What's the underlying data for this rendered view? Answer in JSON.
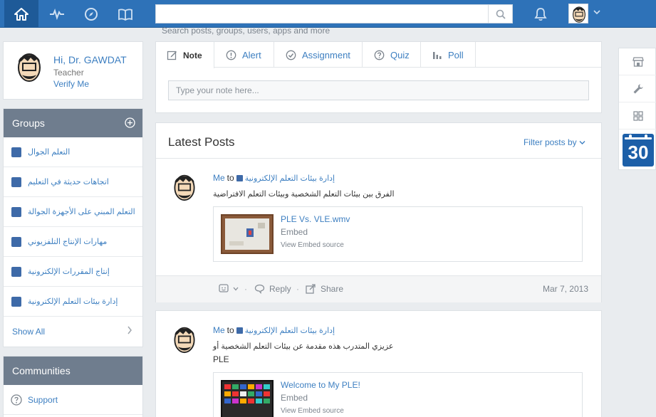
{
  "topbar": {
    "search_placeholder": "",
    "search_hint": "Search posts, groups, users, apps and more"
  },
  "profile": {
    "greeting": "Hi, Dr. GAWDAT",
    "role": "Teacher",
    "verify": "Verify Me"
  },
  "groups": {
    "title": "Groups",
    "items": [
      {
        "label": "التعلم الجوال"
      },
      {
        "label": "اتجاهات حديثة في التعليم"
      },
      {
        "label": "التعلم المبني على الأجهزة الجوالة"
      },
      {
        "label": "مهارات الإنتاج التلفزيوني"
      },
      {
        "label": "إنتاج المقررات الإلكترونية"
      },
      {
        "label": "إدارة بيئات التعلم الإلكترونية"
      }
    ],
    "show_all": "Show All"
  },
  "communities": {
    "title": "Communities",
    "items": [
      {
        "label": "Support"
      }
    ]
  },
  "composer": {
    "tabs": [
      {
        "label": "Note",
        "active": true
      },
      {
        "label": "Alert"
      },
      {
        "label": "Assignment"
      },
      {
        "label": "Quiz"
      },
      {
        "label": "Poll"
      }
    ],
    "placeholder": "Type your note here..."
  },
  "feed": {
    "title": "Latest Posts",
    "filter": "Filter posts by",
    "posts": [
      {
        "author": "Me",
        "to": "to",
        "group": "إدارة بيئات التعلم الإلكترونية",
        "text": "الفرق بين بيئات التعلم الشخصية وبيئات التعلم الافتراضية",
        "embed_title": "PLE Vs. VLE.wmv",
        "embed_kind": "Embed",
        "embed_source": "View Embed source",
        "reply": "Reply",
        "share": "Share",
        "date": "Mar 7, 2013"
      },
      {
        "author": "Me",
        "to": "to",
        "group": "إدارة بيئات التعلم الإلكترونية",
        "text": "عزيزي المتدرب هذه مقدمة عن بيئات التعلم الشخصية أو",
        "text2": "PLE",
        "embed_title": "Welcome to My PLE!",
        "embed_kind": "Embed",
        "embed_source": "View Embed source"
      }
    ]
  },
  "rightbar": {
    "calendar_day": "30"
  },
  "colors": {
    "topbar": "#2e72b8",
    "link": "#3d7fc1",
    "panel_head": "#6f7d8e",
    "group_square": "#3e6aa8"
  }
}
